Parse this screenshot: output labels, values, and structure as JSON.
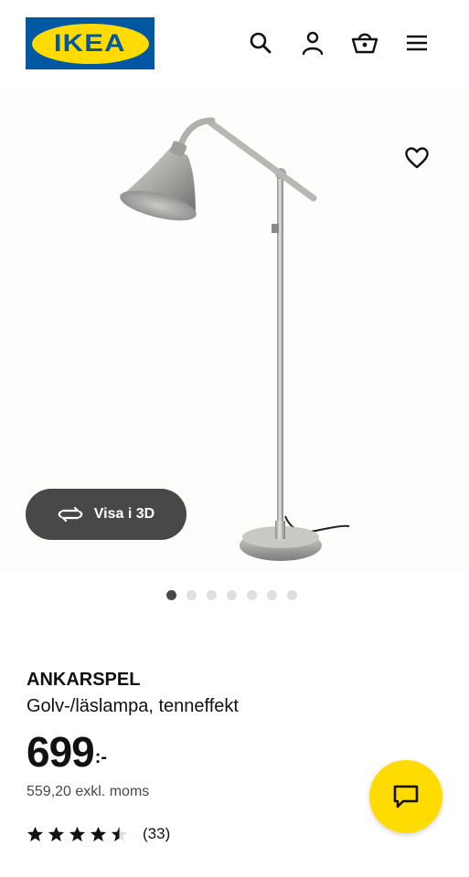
{
  "header": {
    "logo_text": "IKEA",
    "icons": [
      "search-icon",
      "account-icon",
      "shopping-bag-icon",
      "menu-icon"
    ]
  },
  "gallery": {
    "view3d_label": "Visa i 3D",
    "slide_count": 7,
    "active_slide": 1,
    "favorite_icon": "heart-icon"
  },
  "product": {
    "name": "ANKARSPEL",
    "description": "Golv-/läslampa, tenneffekt",
    "price": "699",
    "price_suffix": ":-",
    "price_excl_vat": "559,20 exkl. moms",
    "rating": 4.5,
    "rating_max": 5,
    "rating_count": "(33)"
  },
  "colors": {
    "brand_blue": "#0058a3",
    "brand_yellow": "#ffdb00",
    "dark_button": "#484848"
  }
}
